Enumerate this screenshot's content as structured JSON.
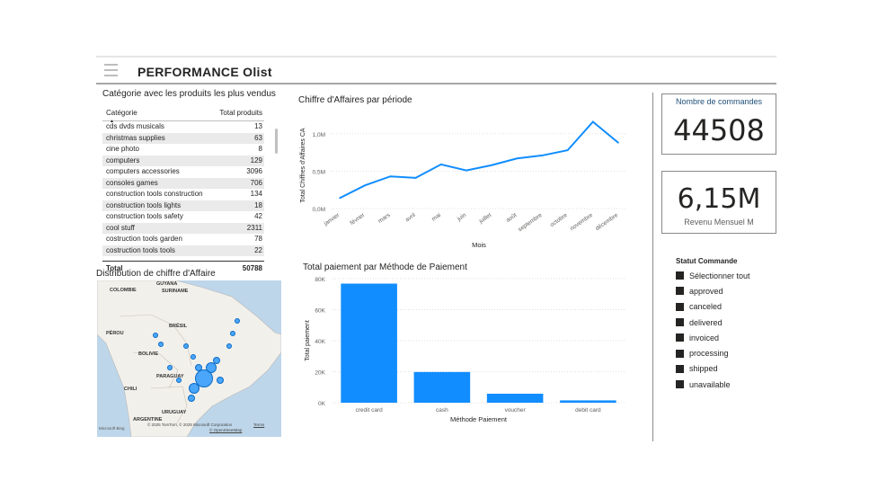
{
  "header": {
    "title": "PERFORMANCE Olist"
  },
  "top_products": {
    "title": "Catégorie avec les produits les plus vendus",
    "col_category": "Catégorie",
    "col_total": "Total produits",
    "rows": [
      {
        "category": "cds dvds musicals",
        "total": "13"
      },
      {
        "category": "christmas supplies",
        "total": "63"
      },
      {
        "category": "cine photo",
        "total": "8"
      },
      {
        "category": "computers",
        "total": "129"
      },
      {
        "category": "computers accessories",
        "total": "3096"
      },
      {
        "category": "consoles games",
        "total": "706"
      },
      {
        "category": "construction tools construction",
        "total": "134"
      },
      {
        "category": "construction tools lights",
        "total": "18"
      },
      {
        "category": "construction tools safety",
        "total": "42"
      },
      {
        "category": "cool stuff",
        "total": "2311"
      },
      {
        "category": "costruction tools garden",
        "total": "78"
      },
      {
        "category": "costruction tools tools",
        "total": "22"
      }
    ],
    "total_label": "Total",
    "total_value": "50788"
  },
  "map": {
    "title": "Distribution de chiffre d'Affaire",
    "labels": [
      "COLOMBIE",
      "GUYANA",
      "SURINAME",
      "BRÉSIL",
      "PÉROU",
      "BOLIVIE",
      "PARAGUAY",
      "CHILI",
      "URUGUAY",
      "ARGENTINE"
    ],
    "attribution": "© 2025 TomTom, © 2025 Microsoft Corporation",
    "terms": "Terms",
    "osm": "© OpenStreetMap",
    "brand": "Microsoft Bing"
  },
  "line_chart": {
    "chart_data": {
      "type": "line",
      "title": "Chiffre d'Affaires par période",
      "xlabel": "Mois",
      "ylabel": "Total Chiffres d'Affaires CA",
      "categories": [
        "janvier",
        "février",
        "mars",
        "avril",
        "mai",
        "juin",
        "juillet",
        "août",
        "septembre",
        "octobre",
        "novembre",
        "décembre"
      ],
      "values": [
        0.14,
        0.31,
        0.43,
        0.41,
        0.59,
        0.51,
        0.58,
        0.67,
        0.71,
        0.78,
        1.16,
        0.88
      ],
      "value_unit": "M",
      "yticks": [
        "0,0M",
        "0,5M",
        "1,0M"
      ],
      "ylim": [
        0,
        1.25
      ],
      "color": "#118dff"
    }
  },
  "bar_chart": {
    "chart_data": {
      "type": "bar",
      "title": "Total paiement par Méthode de Paiement",
      "xlabel": "Méthode Paiement",
      "ylabel": "Total paiement",
      "categories": [
        "credit card",
        "cash",
        "voucher",
        "debit card"
      ],
      "values": [
        76800,
        19800,
        5800,
        1500
      ],
      "yticks": [
        "0K",
        "20K",
        "40K",
        "60K",
        "80K"
      ],
      "ylim": [
        0,
        80000
      ],
      "color": "#118dff"
    }
  },
  "kpi_orders": {
    "label": "Nombre de commandes",
    "value": "44508"
  },
  "kpi_revenue": {
    "value": "6,15M",
    "label": "Revenu Mensuel M"
  },
  "status_filter": {
    "title": "Statut Commande",
    "items": [
      "Sélectionner tout",
      "approved",
      "canceled",
      "delivered",
      "invoiced",
      "processing",
      "shipped",
      "unavailable"
    ]
  },
  "colors": {
    "accent": "#118dff",
    "kpi_label": "#1f4e79"
  }
}
